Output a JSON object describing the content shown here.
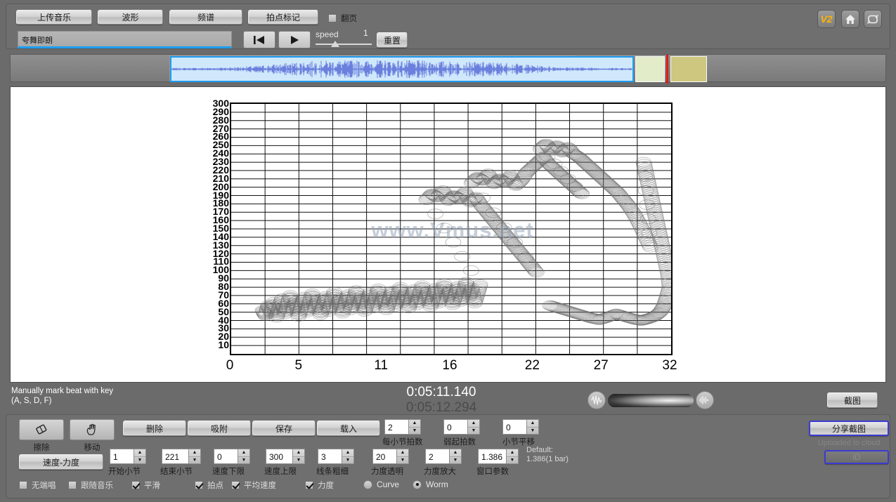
{
  "toolbar": {
    "upload_music": "上传音乐",
    "waveform": "波形",
    "spectrum": "频谱",
    "beat_marker": "拍点标记",
    "page_turn": "翻页",
    "page_turn_checked": false,
    "title_value": "夸舞即朗",
    "speed_label": "speed",
    "speed_value": "1",
    "reset": "重置",
    "prev_icon": "skip-to-start-icon",
    "play_icon": "play-icon",
    "version_badge": "V2",
    "home_icon": "home-icon",
    "fullscreen_icon": "fullscreen-icon"
  },
  "chart_data": {
    "type": "scatter",
    "title": "",
    "xlabel": "",
    "ylabel": "",
    "watermark": "www.Vmus.net",
    "xticks": [
      0,
      5,
      11,
      16,
      22,
      27,
      32
    ],
    "xlim": [
      0,
      32
    ],
    "ylim": [
      0,
      300
    ],
    "yticks": [
      300,
      290,
      280,
      270,
      260,
      250,
      240,
      230,
      220,
      210,
      200,
      190,
      180,
      170,
      160,
      150,
      140,
      130,
      120,
      110,
      100,
      90,
      80,
      70,
      60,
      50,
      40,
      30,
      20,
      10
    ],
    "grid": true,
    "legend": "none",
    "series": [
      {
        "name": "tempo-loudness worm",
        "points": [
          [
            2.3,
            52
          ],
          [
            2.5,
            46
          ],
          [
            2.7,
            58
          ],
          [
            2.9,
            49
          ],
          [
            3.1,
            62
          ],
          [
            3.3,
            44
          ],
          [
            3.5,
            55
          ],
          [
            3.7,
            66
          ],
          [
            3.9,
            48
          ],
          [
            4.1,
            59
          ],
          [
            4.3,
            70
          ],
          [
            4.5,
            52
          ],
          [
            4.7,
            63
          ],
          [
            4.9,
            45
          ],
          [
            5.1,
            57
          ],
          [
            5.3,
            68
          ],
          [
            5.5,
            50
          ],
          [
            5.7,
            61
          ],
          [
            5.9,
            72
          ],
          [
            6.1,
            54
          ],
          [
            6.3,
            65
          ],
          [
            6.5,
            47
          ],
          [
            6.7,
            58
          ],
          [
            6.9,
            69
          ],
          [
            7.1,
            51
          ],
          [
            7.3,
            62
          ],
          [
            7.5,
            74
          ],
          [
            7.7,
            56
          ],
          [
            7.9,
            67
          ],
          [
            8.1,
            49
          ],
          [
            8.3,
            60
          ],
          [
            8.5,
            71
          ],
          [
            8.7,
            53
          ],
          [
            8.9,
            64
          ],
          [
            9.1,
            76
          ],
          [
            9.3,
            58
          ],
          [
            9.5,
            69
          ],
          [
            9.7,
            51
          ],
          [
            9.9,
            62
          ],
          [
            10.1,
            73
          ],
          [
            10.3,
            55
          ],
          [
            10.5,
            66
          ],
          [
            10.7,
            78
          ],
          [
            10.9,
            60
          ],
          [
            11.1,
            71
          ],
          [
            11.3,
            53
          ],
          [
            11.5,
            64
          ],
          [
            11.7,
            75
          ],
          [
            11.9,
            57
          ],
          [
            12.1,
            68
          ],
          [
            12.3,
            80
          ],
          [
            12.5,
            62
          ],
          [
            12.7,
            73
          ],
          [
            12.9,
            55
          ],
          [
            13.1,
            66
          ],
          [
            13.3,
            77
          ],
          [
            13.5,
            59
          ],
          [
            13.7,
            70
          ],
          [
            13.9,
            82
          ],
          [
            14.1,
            64
          ],
          [
            14.3,
            75
          ],
          [
            14.5,
            57
          ],
          [
            14.7,
            68
          ],
          [
            14.9,
            79
          ],
          [
            15.1,
            61
          ],
          [
            15.3,
            72
          ],
          [
            15.5,
            84
          ],
          [
            15.7,
            66
          ],
          [
            15.9,
            77
          ],
          [
            16.1,
            59
          ],
          [
            16.3,
            70
          ],
          [
            16.5,
            81
          ],
          [
            16.7,
            63
          ],
          [
            16.9,
            74
          ],
          [
            17.1,
            86
          ],
          [
            17.3,
            68
          ],
          [
            17.5,
            79
          ],
          [
            17.7,
            61
          ],
          [
            17.9,
            72
          ],
          [
            18.1,
            83
          ],
          [
            14.2,
            185
          ],
          [
            14.6,
            192
          ],
          [
            15.0,
            188
          ],
          [
            15.4,
            196
          ],
          [
            15.8,
            184
          ],
          [
            16.2,
            190
          ],
          [
            16.6,
            186
          ],
          [
            17.0,
            194
          ],
          [
            17.4,
            182
          ],
          [
            17.8,
            188
          ],
          [
            18.2,
            178
          ],
          [
            18.6,
            170
          ],
          [
            19.0,
            162
          ],
          [
            19.4,
            154
          ],
          [
            19.8,
            146
          ],
          [
            20.2,
            138
          ],
          [
            20.6,
            130
          ],
          [
            21.0,
            122
          ],
          [
            21.4,
            114
          ],
          [
            21.8,
            106
          ],
          [
            22.2,
            98
          ],
          [
            17.5,
            205
          ],
          [
            17.9,
            212
          ],
          [
            18.3,
            208
          ],
          [
            18.7,
            216
          ],
          [
            19.1,
            204
          ],
          [
            19.5,
            210
          ],
          [
            19.9,
            206
          ],
          [
            20.3,
            214
          ],
          [
            20.7,
            202
          ],
          [
            21.1,
            208
          ],
          [
            21.5,
            218
          ],
          [
            21.9,
            224
          ],
          [
            22.3,
            230
          ],
          [
            22.7,
            236
          ],
          [
            23.1,
            228
          ],
          [
            23.5,
            222
          ],
          [
            23.9,
            216
          ],
          [
            24.3,
            210
          ],
          [
            24.7,
            204
          ],
          [
            25.1,
            198
          ],
          [
            25.5,
            192
          ],
          [
            22.5,
            246
          ],
          [
            22.9,
            252
          ],
          [
            23.3,
            244
          ],
          [
            23.7,
            250
          ],
          [
            24.1,
            242
          ],
          [
            24.5,
            248
          ],
          [
            24.9,
            240
          ],
          [
            25.3,
            236
          ],
          [
            25.7,
            230
          ],
          [
            26.1,
            224
          ],
          [
            26.5,
            218
          ],
          [
            26.9,
            212
          ],
          [
            27.3,
            206
          ],
          [
            27.7,
            200
          ],
          [
            28.1,
            194
          ],
          [
            28.5,
            186
          ],
          [
            28.9,
            178
          ],
          [
            29.3,
            168
          ],
          [
            29.7,
            156
          ],
          [
            30.1,
            142
          ],
          [
            30.5,
            128
          ],
          [
            30.0,
            230
          ],
          [
            30.2,
            215
          ],
          [
            30.4,
            200
          ],
          [
            30.6,
            185
          ],
          [
            30.8,
            170
          ],
          [
            31.0,
            155
          ],
          [
            31.2,
            140
          ],
          [
            31.4,
            125
          ],
          [
            31.6,
            110
          ],
          [
            31.8,
            95
          ],
          [
            31.9,
            80
          ],
          [
            31.7,
            68
          ],
          [
            31.5,
            58
          ],
          [
            31.2,
            50
          ],
          [
            30.8,
            45
          ],
          [
            30.3,
            42
          ],
          [
            29.8,
            40
          ],
          [
            29.2,
            42
          ],
          [
            28.6,
            45
          ],
          [
            28.0,
            48
          ],
          [
            27.4,
            44
          ],
          [
            26.8,
            41
          ],
          [
            26.2,
            43
          ],
          [
            25.6,
            46
          ],
          [
            25.0,
            49
          ],
          [
            24.4,
            52
          ],
          [
            23.8,
            55
          ],
          [
            23.2,
            58
          ]
        ]
      }
    ]
  },
  "status": {
    "hint_line1": "Manually mark beat with key",
    "hint_line2": "(A, S, D, F)",
    "time_current": "0:05:11.140",
    "time_total": "0:05:12.294",
    "volume_left_icon": "waveform-icon",
    "volume_right_icon": "audio-wave-icon",
    "screenshot": "截图"
  },
  "bottom": {
    "tools": [
      {
        "name": "erase",
        "icon": "eraser-icon",
        "caption": "擦除"
      },
      {
        "name": "move",
        "icon": "hand-icon",
        "caption": "移动"
      }
    ],
    "actions": [
      {
        "name": "delete",
        "label": "删除"
      },
      {
        "name": "snap",
        "label": "吸附"
      },
      {
        "name": "save",
        "label": "保存"
      },
      {
        "name": "load",
        "label": "载入"
      }
    ],
    "spinners_row1": [
      {
        "name": "beats-per-bar",
        "value": "2",
        "caption": "每小节拍数"
      },
      {
        "name": "pickup-beats",
        "value": "0",
        "caption": "弱起拍数"
      },
      {
        "name": "bar-shift",
        "value": "0",
        "caption": "小节平移"
      }
    ],
    "spinners_row2": [
      {
        "name": "start-bar",
        "value": "1",
        "caption": "开始小节"
      },
      {
        "name": "end-bar",
        "value": "221",
        "caption": "结束小节"
      },
      {
        "name": "tempo-min",
        "value": "0",
        "caption": "速度下限"
      },
      {
        "name": "tempo-max",
        "value": "300",
        "caption": "速度上限"
      },
      {
        "name": "line-width",
        "value": "3",
        "caption": "线条粗细"
      },
      {
        "name": "dyn-opacity",
        "value": "20",
        "caption": "力度透明"
      },
      {
        "name": "dyn-scale",
        "value": "2",
        "caption": "力度放大"
      },
      {
        "name": "window-param",
        "value": "1.386",
        "caption": "窗口参数"
      }
    ],
    "tempo_dynamics_label": "速度-力度",
    "default_note_line1": "Default:",
    "default_note_line2": "1.386(1 bar)",
    "checkboxes": [
      {
        "name": "no-singing",
        "label": "无端唱",
        "checked": false
      },
      {
        "name": "follow-music",
        "label": "跟随音乐",
        "checked": false
      },
      {
        "name": "smooth",
        "label": "平滑",
        "checked": true
      },
      {
        "name": "beat",
        "label": "拍点",
        "checked": true
      },
      {
        "name": "average-tempo",
        "label": "平均速度",
        "checked": true
      },
      {
        "name": "dynamics",
        "label": "力度",
        "checked": true
      }
    ],
    "radios": [
      {
        "name": "curve",
        "label": "Curve",
        "selected": false
      },
      {
        "name": "worm",
        "label": "Worm",
        "selected": true
      }
    ],
    "share": "分享截图",
    "upload_note": "Uploaded to cloud",
    "id_button": "iD"
  },
  "colors": {
    "accent_blue": "#1e9cf0",
    "playhead_red": "#e21b12",
    "badge_orange": "#ffb400",
    "share_border": "#3b3bd4"
  }
}
